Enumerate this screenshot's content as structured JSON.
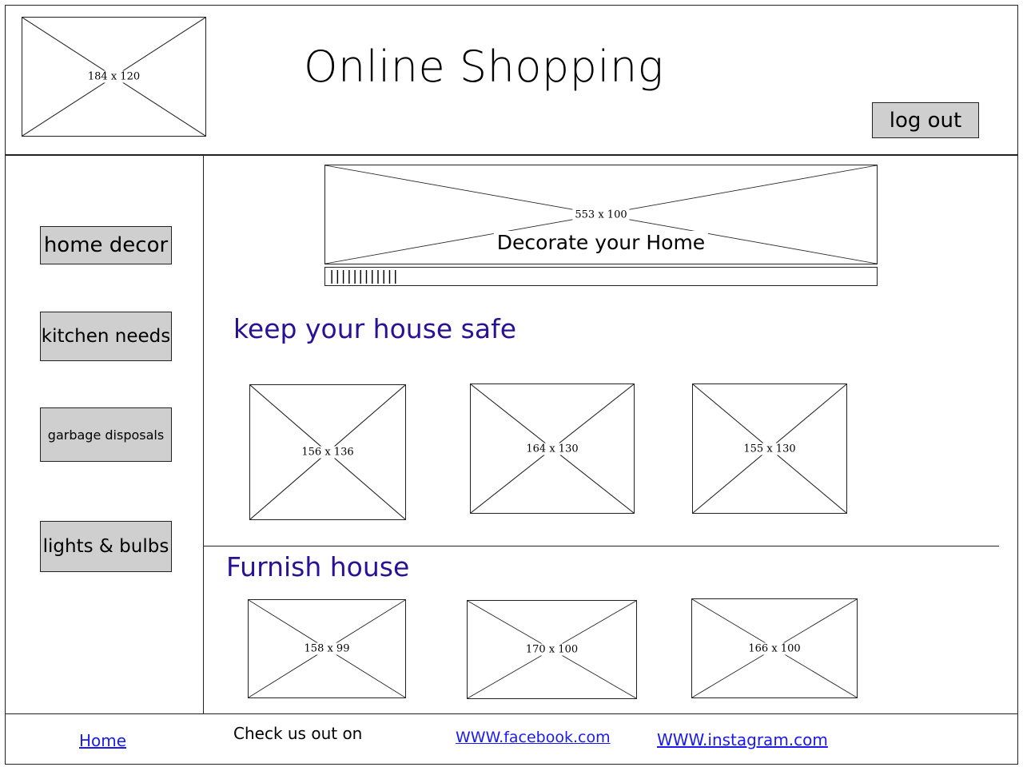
{
  "header": {
    "logo_label": "184 x 120",
    "title": "Online Shopping",
    "logout_label": "log out"
  },
  "sidebar": {
    "items": [
      {
        "label": "home decor"
      },
      {
        "label": "kitchen needs"
      },
      {
        "label": "garbage disposals"
      },
      {
        "label": "lights & bulbs"
      }
    ]
  },
  "banner": {
    "size_label": "553 x 100",
    "caption": "Decorate your Home",
    "progress_ticks": "||||||||||||"
  },
  "section_safe": {
    "heading": "keep your house safe",
    "images": [
      {
        "label": "156 x 136"
      },
      {
        "label": "164 x 130"
      },
      {
        "label": "155 x 130"
      }
    ]
  },
  "section_furnish": {
    "heading": "Furnish house",
    "images": [
      {
        "label": "158 x 99"
      },
      {
        "label": "170 x 100"
      },
      {
        "label": "166 x 100"
      }
    ]
  },
  "footer": {
    "home_link": "Home",
    "check_text": "Check us out on",
    "facebook_link": "WWW.facebook.com",
    "instagram_link": "WWW.instagram.com"
  }
}
